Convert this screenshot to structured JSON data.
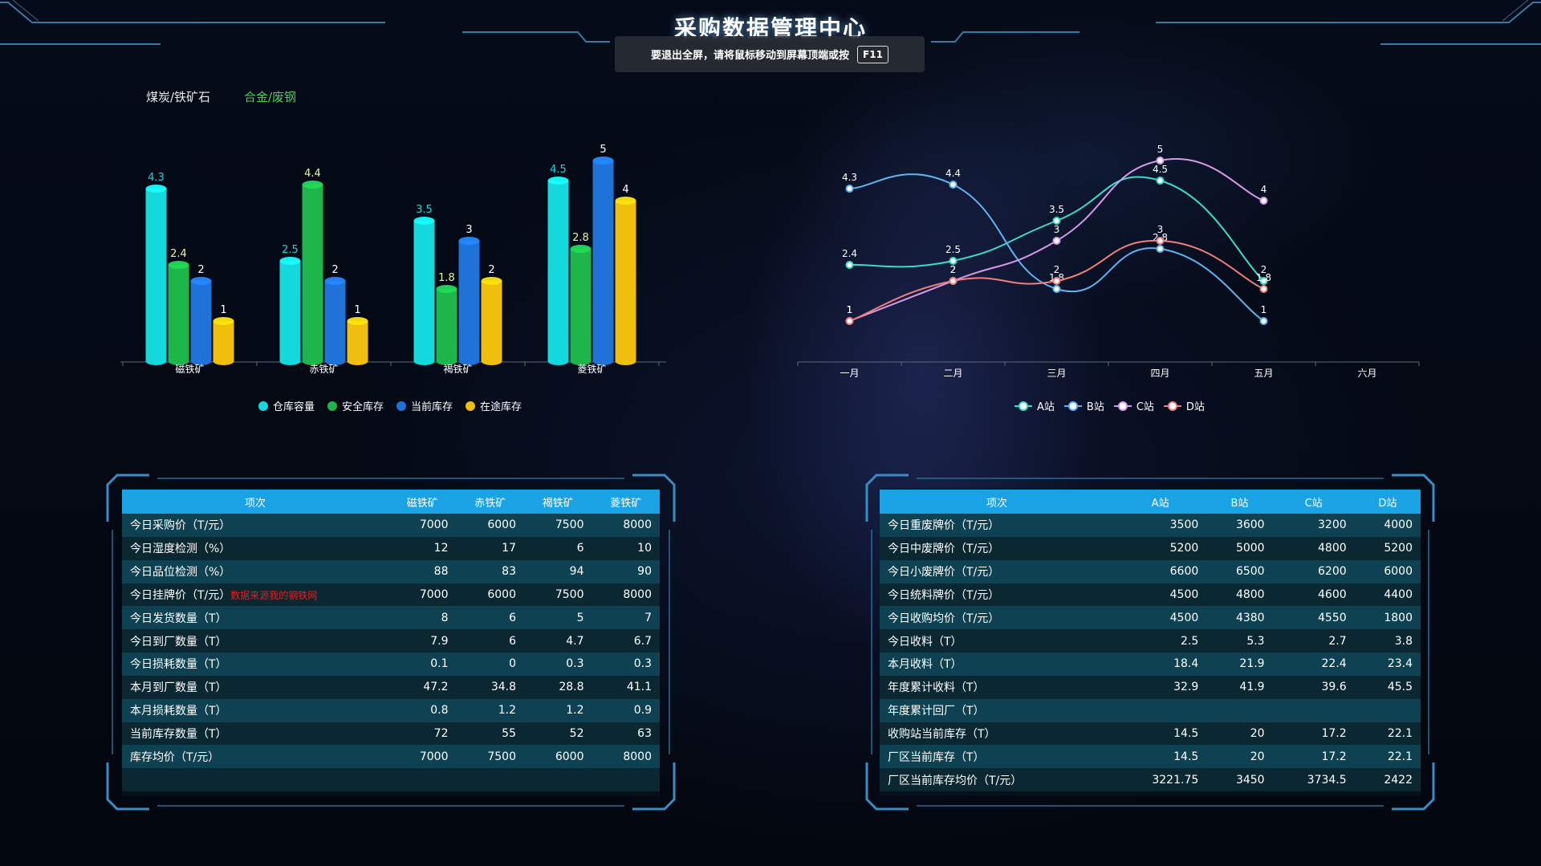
{
  "header": {
    "title": "采购数据管理中心",
    "fullscreen_notice": "要退出全屏，请将鼠标移动到屏幕顶端或按",
    "fullscreen_key": "F11"
  },
  "tabs": [
    {
      "label": "煤炭/铁矿石",
      "active": false
    },
    {
      "label": "合金/废钢",
      "active": true
    }
  ],
  "colors": {
    "cyan": "#13d8dc",
    "green": "#1db64a",
    "blue": "#1f72d8",
    "yellow": "#f0be0c",
    "line_a": "#3ddbc8",
    "line_b": "#5fb4f0",
    "line_c": "#d79ae8",
    "line_d": "#ef7f7c",
    "table_header": "#1aa3e4"
  },
  "chart_data": [
    {
      "type": "bar",
      "categories": [
        "磁铁矿",
        "赤铁矿",
        "褐铁矿",
        "菱铁矿"
      ],
      "ylim": [
        0,
        5
      ],
      "legend_position": "bottom",
      "series": [
        {
          "name": "仓库容量",
          "values": [
            4.3,
            2.5,
            3.5,
            4.5
          ]
        },
        {
          "name": "安全库存",
          "values": [
            2.4,
            4.4,
            1.8,
            2.8
          ]
        },
        {
          "name": "当前库存",
          "values": [
            2,
            2,
            3,
            5
          ]
        },
        {
          "name": "在途库存",
          "values": [
            1,
            1,
            2,
            4
          ]
        }
      ]
    },
    {
      "type": "line",
      "categories": [
        "一月",
        "二月",
        "三月",
        "四月",
        "五月",
        "六月"
      ],
      "ylim": [
        0,
        5
      ],
      "legend_position": "bottom",
      "smooth": true,
      "series": [
        {
          "name": "A站",
          "values": [
            2.4,
            2.5,
            3.5,
            4.5,
            2
          ]
        },
        {
          "name": "B站",
          "values": [
            4.3,
            4.4,
            1.8,
            2.8,
            1
          ]
        },
        {
          "name": "C站",
          "values": [
            1,
            2,
            3,
            5,
            4
          ]
        },
        {
          "name": "D站",
          "values": [
            1,
            2,
            2,
            3,
            1.8
          ]
        }
      ]
    }
  ],
  "left_table": {
    "headers": [
      "项次",
      "磁铁矿",
      "赤铁矿",
      "褐铁矿",
      "菱铁矿"
    ],
    "rows": [
      {
        "label": "今日采购价（T/元）",
        "note": "",
        "values": [
          "7000",
          "6000",
          "7500",
          "8000"
        ]
      },
      {
        "label": "今日湿度检测（%）",
        "note": "",
        "values": [
          "12",
          "17",
          "6",
          "10"
        ]
      },
      {
        "label": "今日品位检测（%）",
        "note": "",
        "values": [
          "88",
          "83",
          "94",
          "90"
        ]
      },
      {
        "label": "今日挂牌价（T/元）",
        "note": "数据来源我的钢铁网",
        "values": [
          "7000",
          "6000",
          "7500",
          "8000"
        ]
      },
      {
        "label": "今日发货数量（T）",
        "note": "",
        "values": [
          "8",
          "6",
          "5",
          "7"
        ]
      },
      {
        "label": "今日到厂数量（T）",
        "note": "",
        "values": [
          "7.9",
          "6",
          "4.7",
          "6.7"
        ]
      },
      {
        "label": "今日损耗数量（T）",
        "note": "",
        "values": [
          "0.1",
          "0",
          "0.3",
          "0.3"
        ]
      },
      {
        "label": "本月到厂数量（T）",
        "note": "",
        "values": [
          "47.2",
          "34.8",
          "28.8",
          "41.1"
        ]
      },
      {
        "label": "本月损耗数量（T）",
        "note": "",
        "values": [
          "0.8",
          "1.2",
          "1.2",
          "0.9"
        ]
      },
      {
        "label": "当前库存数量（T）",
        "note": "",
        "values": [
          "72",
          "55",
          "52",
          "63"
        ]
      },
      {
        "label": "库存均价（T/元）",
        "note": "",
        "values": [
          "7000",
          "7500",
          "6000",
          "8000"
        ]
      },
      {
        "label": "",
        "note": "",
        "values": [
          "",
          "",
          "",
          ""
        ]
      }
    ]
  },
  "right_table": {
    "headers": [
      "项次",
      "A站",
      "B站",
      "C站",
      "D站"
    ],
    "rows": [
      {
        "label": "今日重废牌价（T/元）",
        "values": [
          "3500",
          "3600",
          "3200",
          "4000"
        ]
      },
      {
        "label": "今日中废牌价（T/元）",
        "values": [
          "5200",
          "5000",
          "4800",
          "5200"
        ]
      },
      {
        "label": "今日小废牌价（T/元）",
        "values": [
          "6600",
          "6500",
          "6200",
          "6000"
        ]
      },
      {
        "label": "今日统料牌价（T/元）",
        "values": [
          "4500",
          "4800",
          "4600",
          "4400"
        ]
      },
      {
        "label": "今日收购均价（T/元）",
        "values": [
          "4500",
          "4380",
          "4550",
          "1800"
        ]
      },
      {
        "label": "今日收料（T）",
        "values": [
          "2.5",
          "5.3",
          "2.7",
          "3.8"
        ]
      },
      {
        "label": "本月收料（T）",
        "values": [
          "18.4",
          "21.9",
          "22.4",
          "23.4"
        ]
      },
      {
        "label": "年度累计收料（T）",
        "values": [
          "32.9",
          "41.9",
          "39.6",
          "45.5"
        ]
      },
      {
        "label": "年度累计回厂（T）",
        "values": [
          "",
          "",
          "",
          ""
        ]
      },
      {
        "label": "收购站当前库存（T）",
        "values": [
          "14.5",
          "20",
          "17.2",
          "22.1"
        ]
      },
      {
        "label": "厂区当前库存（T）",
        "values": [
          "14.5",
          "20",
          "17.2",
          "22.1"
        ]
      },
      {
        "label": "厂区当前库存均价（T/元）",
        "values": [
          "3221.75",
          "3450",
          "3734.5",
          "2422"
        ]
      }
    ]
  }
}
